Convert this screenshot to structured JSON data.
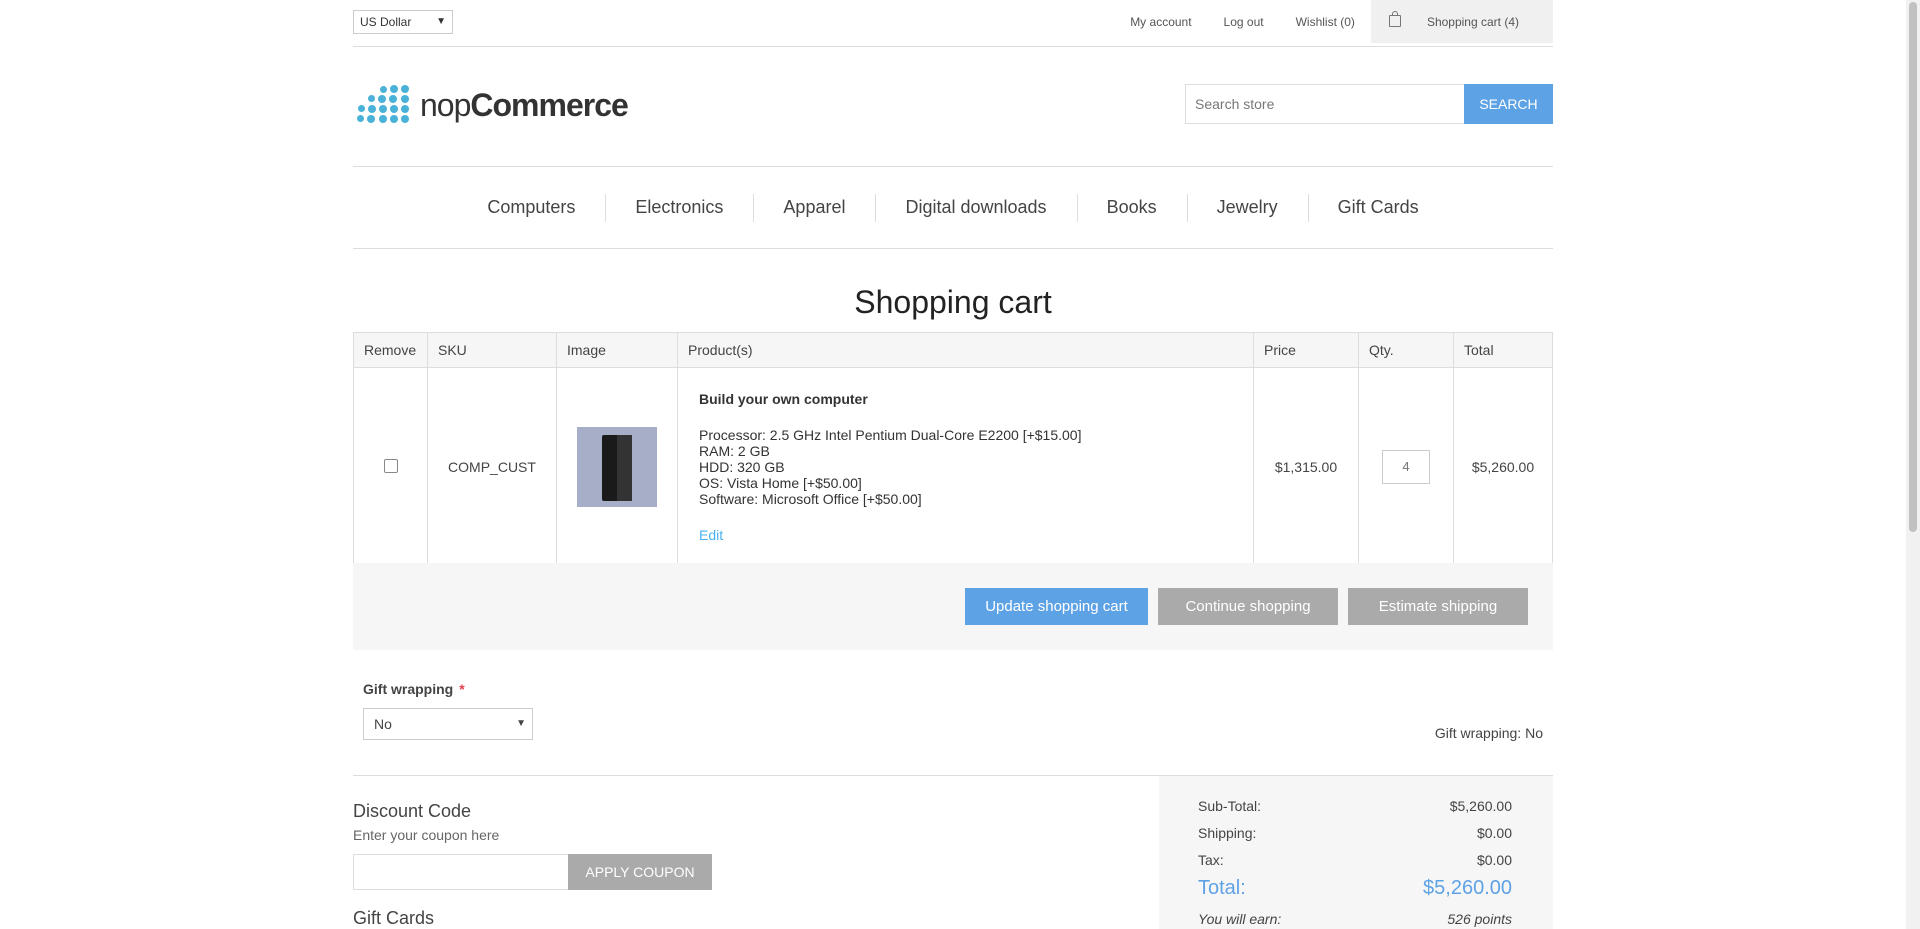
{
  "header": {
    "currency": "US Dollar",
    "links": {
      "my_account": "My account",
      "log_out": "Log out",
      "wishlist": "Wishlist (0)",
      "cart": "Shopping cart (4)"
    }
  },
  "logo": {
    "text_light": "nop",
    "text_bold": "Commerce"
  },
  "search": {
    "placeholder": "Search store",
    "button": "SEARCH"
  },
  "menu": [
    "Computers",
    "Electronics",
    "Apparel",
    "Digital downloads",
    "Books",
    "Jewelry",
    "Gift Cards"
  ],
  "page": {
    "title": "Shopping cart"
  },
  "cart": {
    "columns": [
      "Remove",
      "SKU",
      "Image",
      "Product(s)",
      "Price",
      "Qty.",
      "Total"
    ],
    "items": [
      {
        "sku": "COMP_CUST",
        "name": "Build your own computer",
        "attributes": [
          "Processor: 2.5 GHz Intel Pentium Dual-Core E2200 [+$15.00]",
          "RAM: 2 GB",
          "HDD: 320 GB",
          "OS: Vista Home [+$50.00]",
          "Software: Microsoft Office [+$50.00]"
        ],
        "edit": "Edit",
        "price": "$1,315.00",
        "qty": "4",
        "total": "$5,260.00"
      }
    ],
    "buttons": {
      "update": "Update shopping cart",
      "continue": "Continue shopping",
      "estimate": "Estimate shipping"
    }
  },
  "gift_wrapping": {
    "label": "Gift wrapping",
    "required_mark": "*",
    "value": "No",
    "summary": "Gift wrapping: No"
  },
  "discount": {
    "title": "Discount Code",
    "hint": "Enter your coupon here",
    "input_value": "",
    "button": "APPLY COUPON"
  },
  "gift_cards": {
    "title": "Gift Cards"
  },
  "totals": {
    "subtotal_label": "Sub-Total:",
    "subtotal": "$5,260.00",
    "shipping_label": "Shipping:",
    "shipping": "$0.00",
    "tax_label": "Tax:",
    "tax": "$0.00",
    "total_label": "Total:",
    "total": "$5,260.00",
    "earn_label": "You will earn:",
    "earn": "526 points"
  },
  "colors": {
    "accent": "#5ea2e6",
    "button_grey": "#aaaaaa",
    "link": "#4ab2f1",
    "required": "#e4434b",
    "logo": "#4ab2d8"
  },
  "icons": {
    "cart": "shopping-bag-icon",
    "select": "chevron-down-icon"
  }
}
